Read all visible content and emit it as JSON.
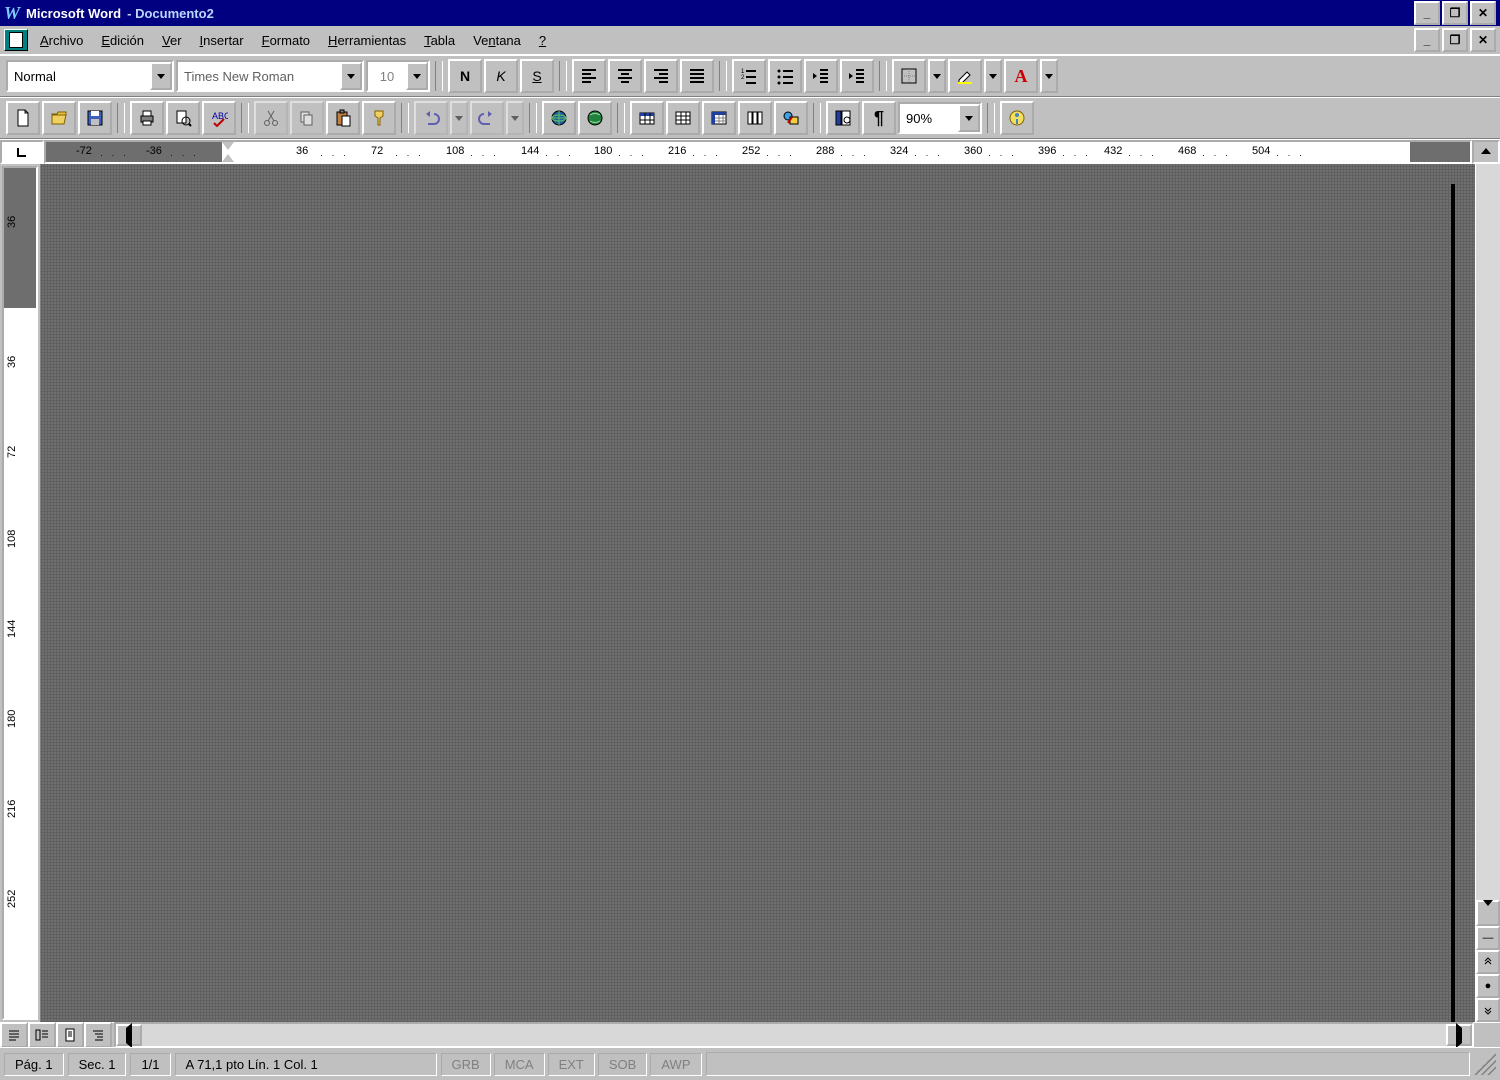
{
  "title": {
    "app": "Microsoft Word",
    "doc": "Documento2"
  },
  "menu": {
    "items": [
      {
        "pre": "",
        "u": "A",
        "post": "rchivo"
      },
      {
        "pre": "",
        "u": "E",
        "post": "dición"
      },
      {
        "pre": "",
        "u": "V",
        "post": "er"
      },
      {
        "pre": "",
        "u": "I",
        "post": "nsertar"
      },
      {
        "pre": "",
        "u": "F",
        "post": "ormato"
      },
      {
        "pre": "",
        "u": "H",
        "post": "erramientas"
      },
      {
        "pre": "",
        "u": "T",
        "post": "abla"
      },
      {
        "pre": "Ve",
        "u": "n",
        "post": "tana"
      },
      {
        "pre": "",
        "u": "?",
        "post": ""
      }
    ]
  },
  "formatbar": {
    "style": "Normal",
    "font": "Times New Roman",
    "size": "10",
    "bold": "N",
    "italic": "K",
    "underline": "S"
  },
  "std_toolbar": {
    "zoom": "90%"
  },
  "hruler": {
    "labels": [
      "-72",
      "-36",
      "36",
      "72",
      "108",
      "144",
      "180",
      "216",
      "252",
      "288",
      "324",
      "360",
      "396",
      "432",
      "468",
      "504"
    ]
  },
  "vruler": {
    "labels": [
      "36",
      "36",
      "72",
      "108",
      "144",
      "180",
      "216",
      "252"
    ]
  },
  "status": {
    "page": "Pág. 1",
    "sec": "Sec. 1",
    "pages": "1/1",
    "pos": "A 71,1 pto Lín. 1    Col. 1",
    "ind": [
      "GRB",
      "MCA",
      "EXT",
      "SOB",
      "AWP"
    ]
  }
}
